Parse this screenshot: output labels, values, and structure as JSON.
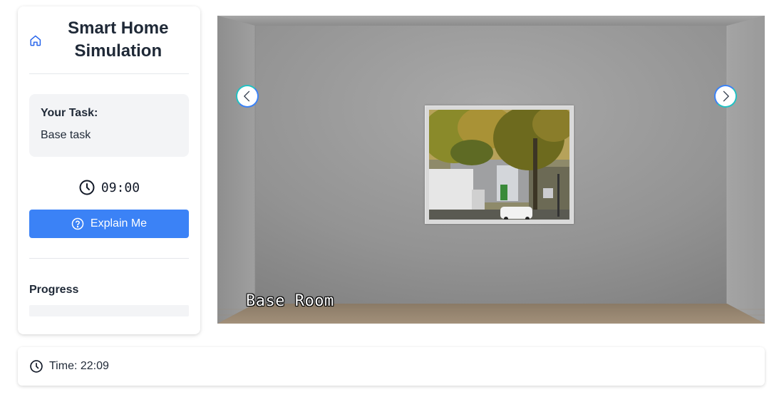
{
  "app": {
    "title": "Smart Home Simulation"
  },
  "task": {
    "label": "Your Task:",
    "text": "Base task"
  },
  "timer": {
    "value": "09:00"
  },
  "buttons": {
    "explain_label": "Explain Me"
  },
  "progress": {
    "label": "Progress",
    "percent": 0
  },
  "room": {
    "name": "Base Room"
  },
  "status": {
    "time_text": "Time: 22:09"
  },
  "colors": {
    "accent": "#3b82f6",
    "arrow_ring": "#2dd4bf",
    "card_bg": "#f3f4f6"
  },
  "icons": {
    "brand": "home-icon",
    "timer": "clock-icon",
    "explain": "question-circle-icon",
    "prev": "chevron-left-icon",
    "next": "chevron-right-icon",
    "status": "clock-icon"
  }
}
